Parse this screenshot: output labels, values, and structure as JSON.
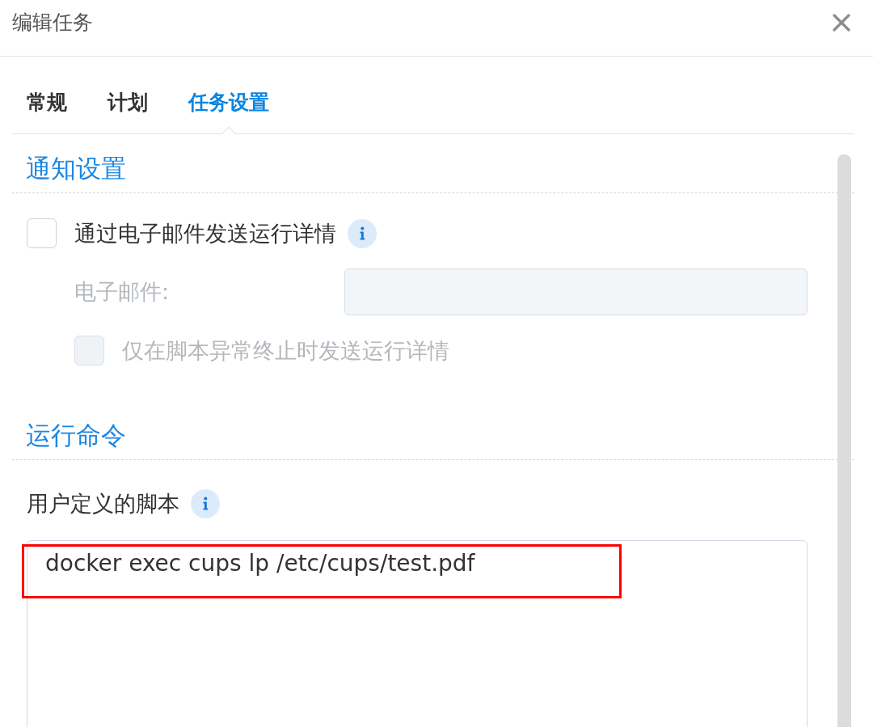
{
  "dialog": {
    "title": "编辑任务"
  },
  "tabs": [
    {
      "label": "常规",
      "selected": false
    },
    {
      "label": "计划",
      "selected": false
    },
    {
      "label": "任务设置",
      "selected": true
    }
  ],
  "sections": [
    {
      "title": "通知设置",
      "items": [
        {
          "kind": "checkbox",
          "label": "通过电子邮件发送运行详情",
          "checked": false,
          "disabled": false,
          "info": true,
          "children": [
            {
              "kind": "field",
              "label": "电子邮件:",
              "disabled": true
            },
            {
              "kind": "checkbox",
              "label": "仅在脚本异常终止时发送运行详情",
              "checked": false,
              "disabled": true
            }
          ]
        }
      ]
    },
    {
      "title": "运行命令",
      "items": [
        {
          "kind": "label",
          "label": "用户定义的脚本",
          "info": true
        },
        {
          "kind": "textarea",
          "value": "docker exec cups lp /etc/cups/test.pdf",
          "highlighted": true
        }
      ]
    }
  ]
}
